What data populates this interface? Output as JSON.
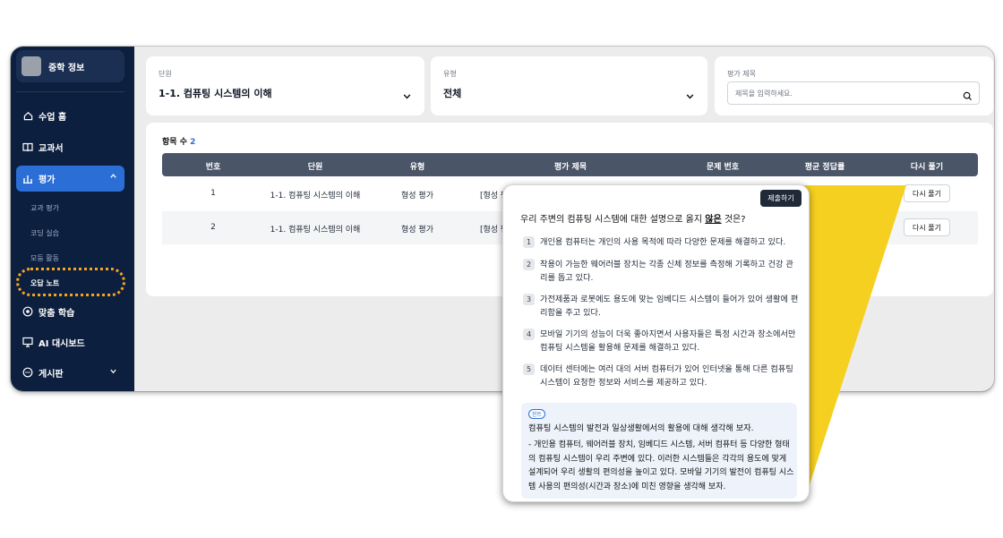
{
  "sidebar": {
    "brand": "중학 정보",
    "nav": [
      {
        "label": "수업 홈"
      },
      {
        "label": "교과서"
      },
      {
        "label": "평가"
      },
      {
        "label": "맞춤 학습"
      },
      {
        "label": "AI 대시보드"
      },
      {
        "label": "게시판"
      }
    ],
    "sub": [
      "교과 평가",
      "코딩 실습",
      "모둠 활동",
      "오답 노트"
    ]
  },
  "filters": {
    "unit_label": "단원",
    "unit_value": "1-1. 컴퓨팅 시스템의 이해",
    "type_label": "유형",
    "type_value": "전체",
    "title_label": "평가 제목",
    "title_placeholder": "제목을 입력하세요."
  },
  "table": {
    "count_label": "항목 수",
    "count_value": "2",
    "headers": [
      "번호",
      "단원",
      "유형",
      "평가 제목",
      "문제 번호",
      "평균 정답률",
      "다시 풀기"
    ],
    "rows": [
      {
        "no": "1",
        "unit": "1-1. 컴퓨팅 시스템의 이해",
        "type": "형성 평가",
        "title": "[형성 평",
        "retry": "다시 풀기"
      },
      {
        "no": "2",
        "unit": "1-1. 컴퓨팅 시스템의 이해",
        "type": "형성 평가",
        "title": "[형성 평",
        "retry": "다시 풀기"
      }
    ]
  },
  "popup": {
    "submit": "제출하기",
    "question_pre": "우리 주변의 컴퓨팅 시스템에 대한 설명으로 옳지 ",
    "question_em": "않은",
    "question_post": " 것은?",
    "options": [
      {
        "num": "1",
        "text": "개인용 컴퓨터는 개인의 사용 목적에 따라 다양한 문제를 해결하고 있다."
      },
      {
        "num": "2",
        "text": "착용이 가능한 웨어러블 장치는 각종 신체 정보를 측정해 기록하고 건강 관리를 돕고 있다."
      },
      {
        "num": "3",
        "text": "가전제품과 로봇에도 용도에 맞는 임베디드 시스템이 들어가 있어 생활에 편리함을 주고 있다."
      },
      {
        "num": "4",
        "text": "모바일 기기의 성능이 더욱 좋아지면서 사용자들은 특정 시간과 장소에서만 컴퓨팅 시스템을 활용해 문제를 해결하고 있다."
      },
      {
        "num": "5",
        "text": "데이터 센터에는 여러 대의 서버 컴퓨터가 있어 인터넷을 통해 다른 컴퓨팅 시스템이 요청한 정보와 서비스를 제공하고 있다."
      }
    ],
    "hint_tag": "힌트",
    "hint_title": "컴퓨팅 시스템의 발전과 일상생활에서의 활용에 대해 생각해 보자.",
    "hint_body": "- 개인용 컴퓨터, 웨어러블 장치, 임베디드 시스템, 서버 컴퓨터 등 다양한 형태의 컴퓨팅 시스템이 우리 주변에 있다. 이러한 시스템들은 각각의 용도에 맞게 설계되어 우리 생활의 편의성을 높이고 있다. 모바일 기기의 발전이 컴퓨팅 시스템 사용의 편의성(시간과 장소)에 미친 영향을 생각해 보자."
  },
  "colors": {
    "sidebar": "#0d1f3f",
    "accent": "#2b6fd6",
    "callout": "#f5d020",
    "highlight": "#f5a623"
  }
}
